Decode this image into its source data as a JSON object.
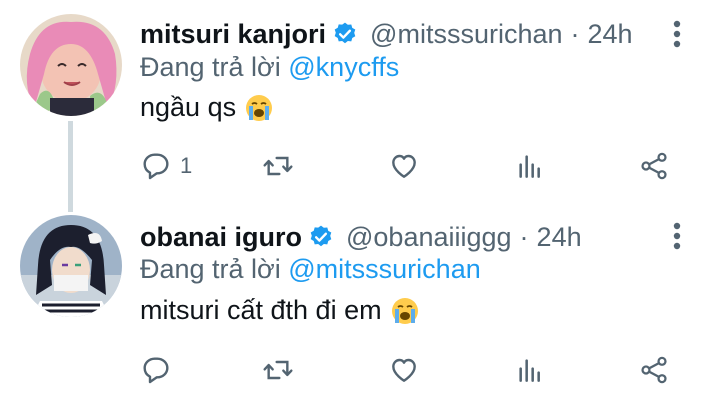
{
  "tweets": [
    {
      "name": "mitsuri kanjori",
      "handle": "@mitsssurichan",
      "separator": "·",
      "time": "24h",
      "replying_prefix": "Đang trả lời ",
      "replying_to": "@knycffs",
      "text": "ngầu qs",
      "reply_count": "1",
      "emoji": "loudly-crying-face"
    },
    {
      "name": "obanai iguro",
      "handle": "@obanaiiiggg",
      "separator": "·",
      "time": "24h",
      "replying_prefix": "Đang trả lời ",
      "replying_to": "@mitsssurichan",
      "text": "mitsuri cất đth đi em",
      "reply_count": "",
      "emoji": "loudly-crying-face"
    }
  ],
  "colors": {
    "accent": "#1d9bf0",
    "secondary_text": "#536471",
    "icon": "#536471",
    "thread_line": "#cfd9de"
  }
}
